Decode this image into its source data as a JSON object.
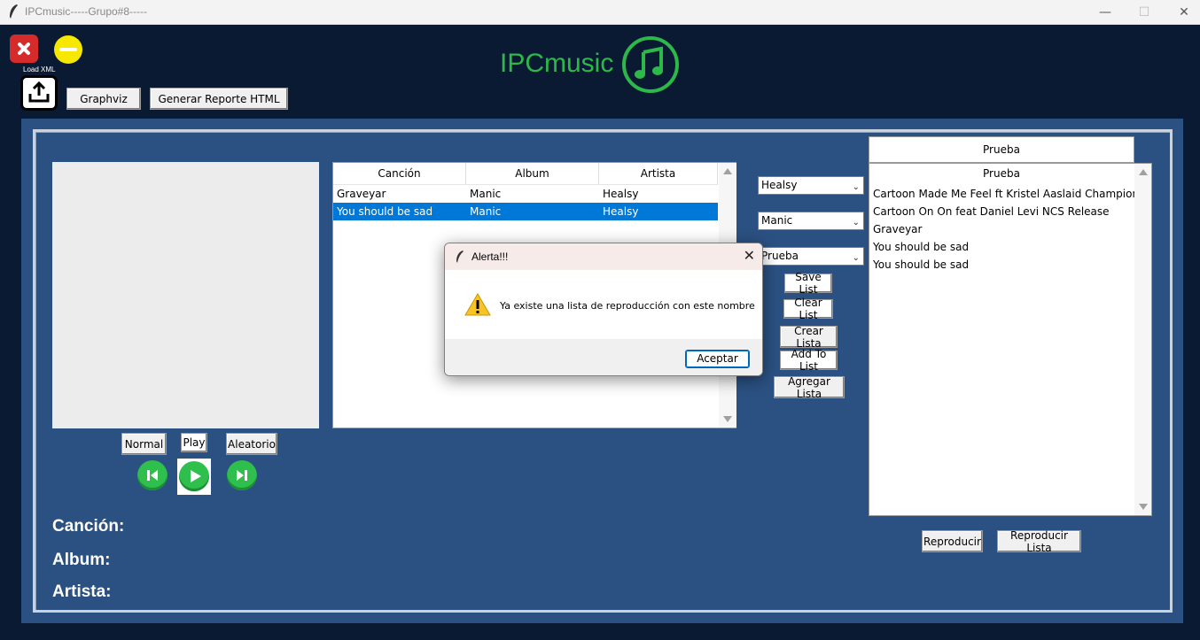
{
  "window": {
    "title": "IPCmusic-----Grupo#8-----",
    "minimize_glyph": "—",
    "maximize_glyph": "☐",
    "close_glyph": "✕"
  },
  "header": {
    "load_xml_label": "Load XML",
    "graphviz_label": "Graphviz",
    "report_label": "Generar Reporte HTML",
    "logo_text": "IPCmusic",
    "logo_icon": "music-note-icon",
    "accent_color": "#2db84a"
  },
  "songs_table": {
    "columns": [
      "Canción",
      "Album",
      "Artista"
    ],
    "rows": [
      {
        "song": "Graveyar",
        "album": "Manic",
        "artist": "Healsy"
      },
      {
        "song": "You should be sad",
        "album": "Manic",
        "artist": "Healsy"
      }
    ],
    "selected_row": 1
  },
  "player": {
    "normal_label": "Normal",
    "play_label": "Play",
    "random_label": "Aleatorio"
  },
  "info": {
    "song_label": "Canción:",
    "album_label": "Album:",
    "artist_label": "Artista:"
  },
  "filters": {
    "artist_value": "Healsy",
    "album_value": "Manic",
    "playlist_value": "Prueba"
  },
  "actions": {
    "save_list": "Save List",
    "clear_list": "Clear List",
    "create_list": "Crear Lista",
    "add_to_list": "Add To List",
    "add_list": "Agregar Lista"
  },
  "playlist": {
    "header": "Prueba",
    "title": "Prueba",
    "items": [
      "Cartoon  Made Me Feel ft Kristel Aaslaid Champion Rer",
      "Cartoon  On  On feat Daniel Levi NCS Release",
      "Graveyar",
      "You should be sad",
      "You should be sad"
    ],
    "play_label": "Reproducir",
    "play_list_label": "Reproducir Lista"
  },
  "dialog": {
    "title": "Alerta!!!",
    "message": "Ya existe una lista de reproducción con este nombre",
    "ok_label": "Aceptar",
    "close_glyph": "✕"
  }
}
